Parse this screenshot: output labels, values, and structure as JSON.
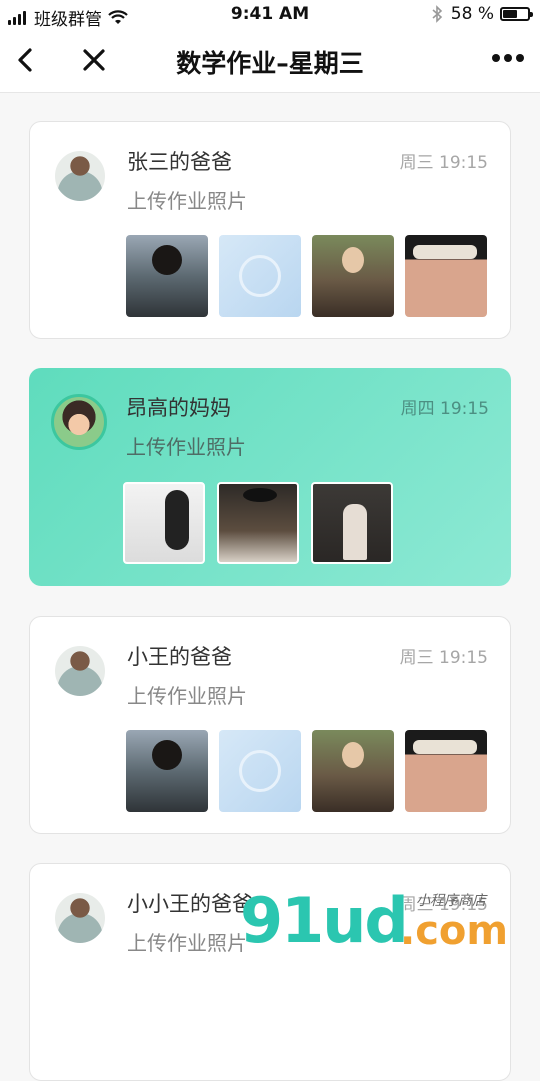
{
  "status_bar": {
    "carrier": "班级群管",
    "time": "9:41 AM",
    "battery": "58 %",
    "battery_level": 0.58
  },
  "nav": {
    "title": "数学作业–星期三",
    "back_icon": "chevron-left-icon",
    "close_icon": "close-icon",
    "more_icon": "more-dots-icon"
  },
  "cards": [
    {
      "name": "张三的爸爸",
      "time": "周三 19:15",
      "desc": "上传作业照片",
      "active": false
    },
    {
      "name": "昂高的妈妈",
      "time": "周四 19:15",
      "desc": "上传作业照片",
      "active": true
    },
    {
      "name": "小王的爸爸",
      "time": "周三 19:15",
      "desc": "上传作业照片",
      "active": false
    },
    {
      "name": "小小王的爸爸",
      "time": "周三 19:15",
      "desc": "上传作业照片",
      "active": false
    }
  ],
  "watermark": {
    "main": "91ud",
    "suffix": ".com",
    "small": "小程序商店"
  },
  "colors": {
    "accent_gradient_start": "#5fdcbd",
    "accent_gradient_end": "#8de9d4"
  }
}
